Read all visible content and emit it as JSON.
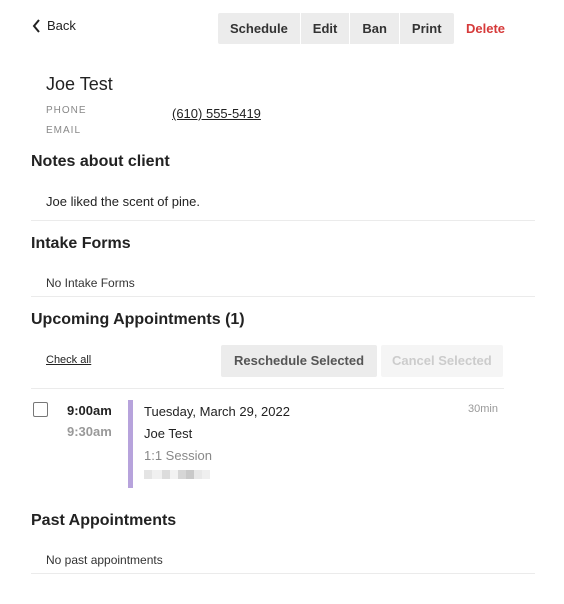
{
  "nav": {
    "back_label": "Back"
  },
  "toolbar": {
    "buttons": [
      "Schedule",
      "Edit",
      "Ban",
      "Print"
    ],
    "delete_label": "Delete"
  },
  "client": {
    "name": "Joe Test",
    "phone_label": "PHONE",
    "phone": "(610) 555-5419",
    "email_label": "EMAIL"
  },
  "notes": {
    "title": "Notes about client",
    "text": "Joe liked the scent of pine."
  },
  "intake": {
    "title": "Intake Forms",
    "empty_text": "No Intake Forms"
  },
  "upcoming": {
    "title": "Upcoming Appointments (1)",
    "check_all_label": "Check all",
    "reschedule_label": "Reschedule Selected",
    "cancel_label": "Cancel Selected",
    "appointments": [
      {
        "start": "9:00am",
        "end": "9:30am",
        "date": "Tuesday, March 29, 2022",
        "client": "Joe Test",
        "service": "1:1 Session",
        "duration": "30min",
        "accent_color": "#b7a3dc"
      }
    ]
  },
  "past": {
    "title": "Past Appointments",
    "empty_text": "No past appointments"
  },
  "colors": {
    "danger": "#d63a3a",
    "accent": "#b7a3dc"
  }
}
